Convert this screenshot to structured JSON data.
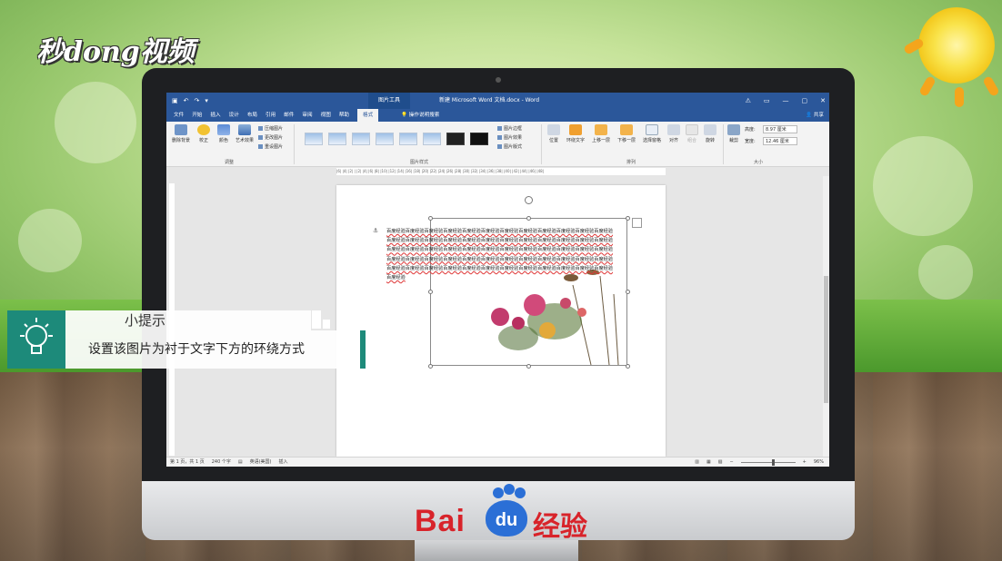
{
  "watermark_logo": "秒dong视频",
  "brand_footer": {
    "text": "Bai",
    "du": "du",
    "cn": "经验"
  },
  "word": {
    "context_tab": "图片工具",
    "doc_title": "新建 Microsoft Word 文档.docx - Word",
    "tabs": [
      "文件",
      "开始",
      "插入",
      "设计",
      "布局",
      "引用",
      "邮件",
      "审阅",
      "视图",
      "帮助",
      "格式"
    ],
    "active_tab": "格式",
    "tell_me": "操作说明搜索",
    "share": "共享",
    "ribbon": {
      "adjust": {
        "remove_bg": "删除背景",
        "correct": "校正",
        "color": "颜色",
        "art": "艺术效果",
        "compress": "压缩图片",
        "change": "更改图片",
        "reset": "重设图片",
        "label": "调整"
      },
      "styles": {
        "border": "图片边框",
        "effects": "图片效果",
        "layout": "图片版式",
        "label": "图片样式"
      },
      "arrange": {
        "position": "位置",
        "wrap": "环绕文字",
        "forward": "上移一层",
        "backward": "下移一层",
        "pane": "选择窗格",
        "align": "对齐",
        "group": "组合",
        "rotate": "旋转",
        "label": "排列"
      },
      "size": {
        "crop": "裁剪",
        "height_label": "高度:",
        "height": "8.97 厘米",
        "width_label": "宽度:",
        "width": "12.46 厘米",
        "label": "大小"
      }
    },
    "ruler_text": "|6| |4| |2| | |2| |4| |6| |8| |10| |12| |14| |16| |18| |20| |22| |24| |26| |28| |30| |32| |34| |36| |38| |40| |42| |44| |46| |48|",
    "body_text": "百度经验百度经验百度经验百度经验百度经验百度经验百度经验百度经验百度经验百度经验百度经验百度经验百度经验百度经验百度经验百度经验百度经验百度经验百度经验百度经验百度经验百度经验百度经验百度经验百度经验百度经验百度经验百度经验百度经验百度经验百度经验百度经验百度经验百度经验百度经验百度经验百度经验百度经验百度经验百度经验百度经验百度经验百度经验百度经验百度经验百度经验百度经验百度经验百度经验百度经验百度经验百度经验百度经验百度经验百度经验百度经验百度经验百度经验百度经验百度经验百度经验",
    "status": {
      "page": "第 1 页，共 1 页",
      "words": "240 个字",
      "lang": "英语(美国)",
      "mode": "插入",
      "zoom": "96%"
    }
  },
  "tip": {
    "title": "小提示",
    "body": "设置该图片为衬于文字下方的环绕方式"
  }
}
